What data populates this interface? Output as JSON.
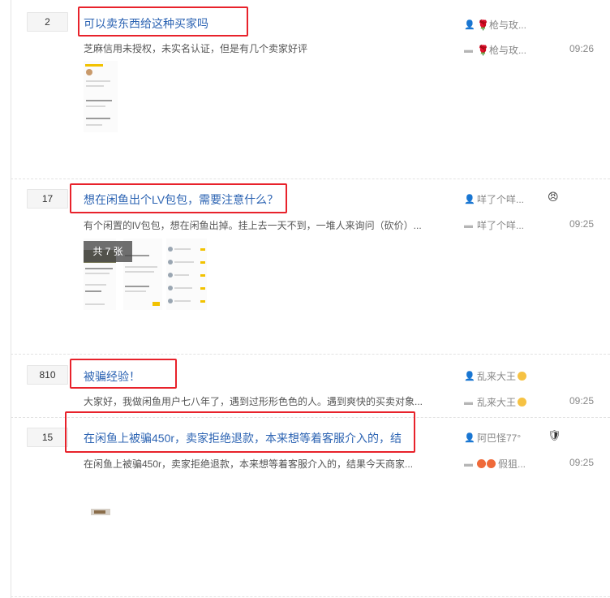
{
  "posts": [
    {
      "count": "2",
      "title": "可以卖东西给这种买家吗",
      "summary": "芝麻信用未授权，未实名认证，但是有几个卖家好评",
      "author": "🌹枪与玫...",
      "last_reply": "🌹枪与玫...",
      "time": "09:26"
    },
    {
      "count": "17",
      "title": "想在闲鱼出个LV包包，需要注意什么？",
      "summary": "有个闲置的lV包包，想在闲鱼出掉。挂上去一天不到，一堆人来询问（砍价）...",
      "author": "咩了个咩...",
      "last_reply": "咩了个咩...",
      "time": "09:25",
      "image_count": "共 7 张"
    },
    {
      "count": "810",
      "title": "被骗经验！",
      "summary": "大家好，我做闲鱼用户七八年了，遇到过形形色色的人。遇到爽快的买卖对象...",
      "author": "乱来大王",
      "last_reply": "乱来大王",
      "time": "09:25"
    },
    {
      "count": "15",
      "title": "在闲鱼上被骗450r，卖家拒绝退款，本来想等着客服介入的，结",
      "summary": "在闲鱼上被骗450r，卖家拒绝退款，本来想等着客服介入的，结果今天商家...",
      "author": "阿巴怪77°",
      "last_reply": "假狙...",
      "time": "09:25"
    }
  ],
  "icons": {
    "author": "user-icon",
    "reply": "comment-icon"
  },
  "colors": {
    "title_link": "#2d64b3",
    "highlight_box": "#e8222b"
  }
}
